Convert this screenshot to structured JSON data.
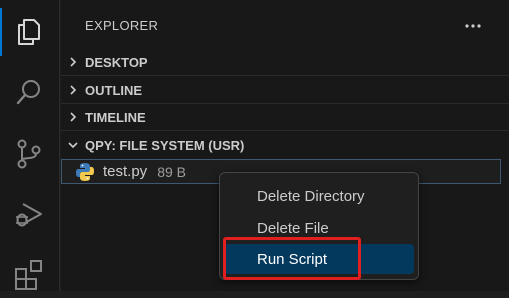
{
  "activity_bar": {
    "items": [
      {
        "name": "explorer",
        "icon": "files-icon",
        "active": true
      },
      {
        "name": "search",
        "icon": "search-icon",
        "active": false
      },
      {
        "name": "source-control",
        "icon": "source-control-icon",
        "active": false
      },
      {
        "name": "run-and-debug",
        "icon": "debug-icon",
        "active": false
      },
      {
        "name": "extensions",
        "icon": "extensions-icon",
        "active": false
      }
    ]
  },
  "sidebar": {
    "title": "EXPLORER",
    "more_actions_icon": "ellipsis-icon",
    "sections": [
      {
        "label": "DESKTOP",
        "expanded": false
      },
      {
        "label": "OUTLINE",
        "expanded": false
      },
      {
        "label": "TIMELINE",
        "expanded": false
      },
      {
        "label": "QPY: FILE SYSTEM (USR)",
        "expanded": true
      }
    ],
    "file": {
      "name": "test.py",
      "size": "89 B",
      "icon": "python-icon"
    }
  },
  "context_menu": {
    "items": [
      {
        "label": "Delete Directory",
        "selected": false
      },
      {
        "label": "Delete File",
        "selected": false
      },
      {
        "label": "Run Script",
        "selected": true
      }
    ]
  },
  "colors": {
    "accent": "#0078d4",
    "selection": "#04395e",
    "highlight_annotation": "#e02020"
  }
}
